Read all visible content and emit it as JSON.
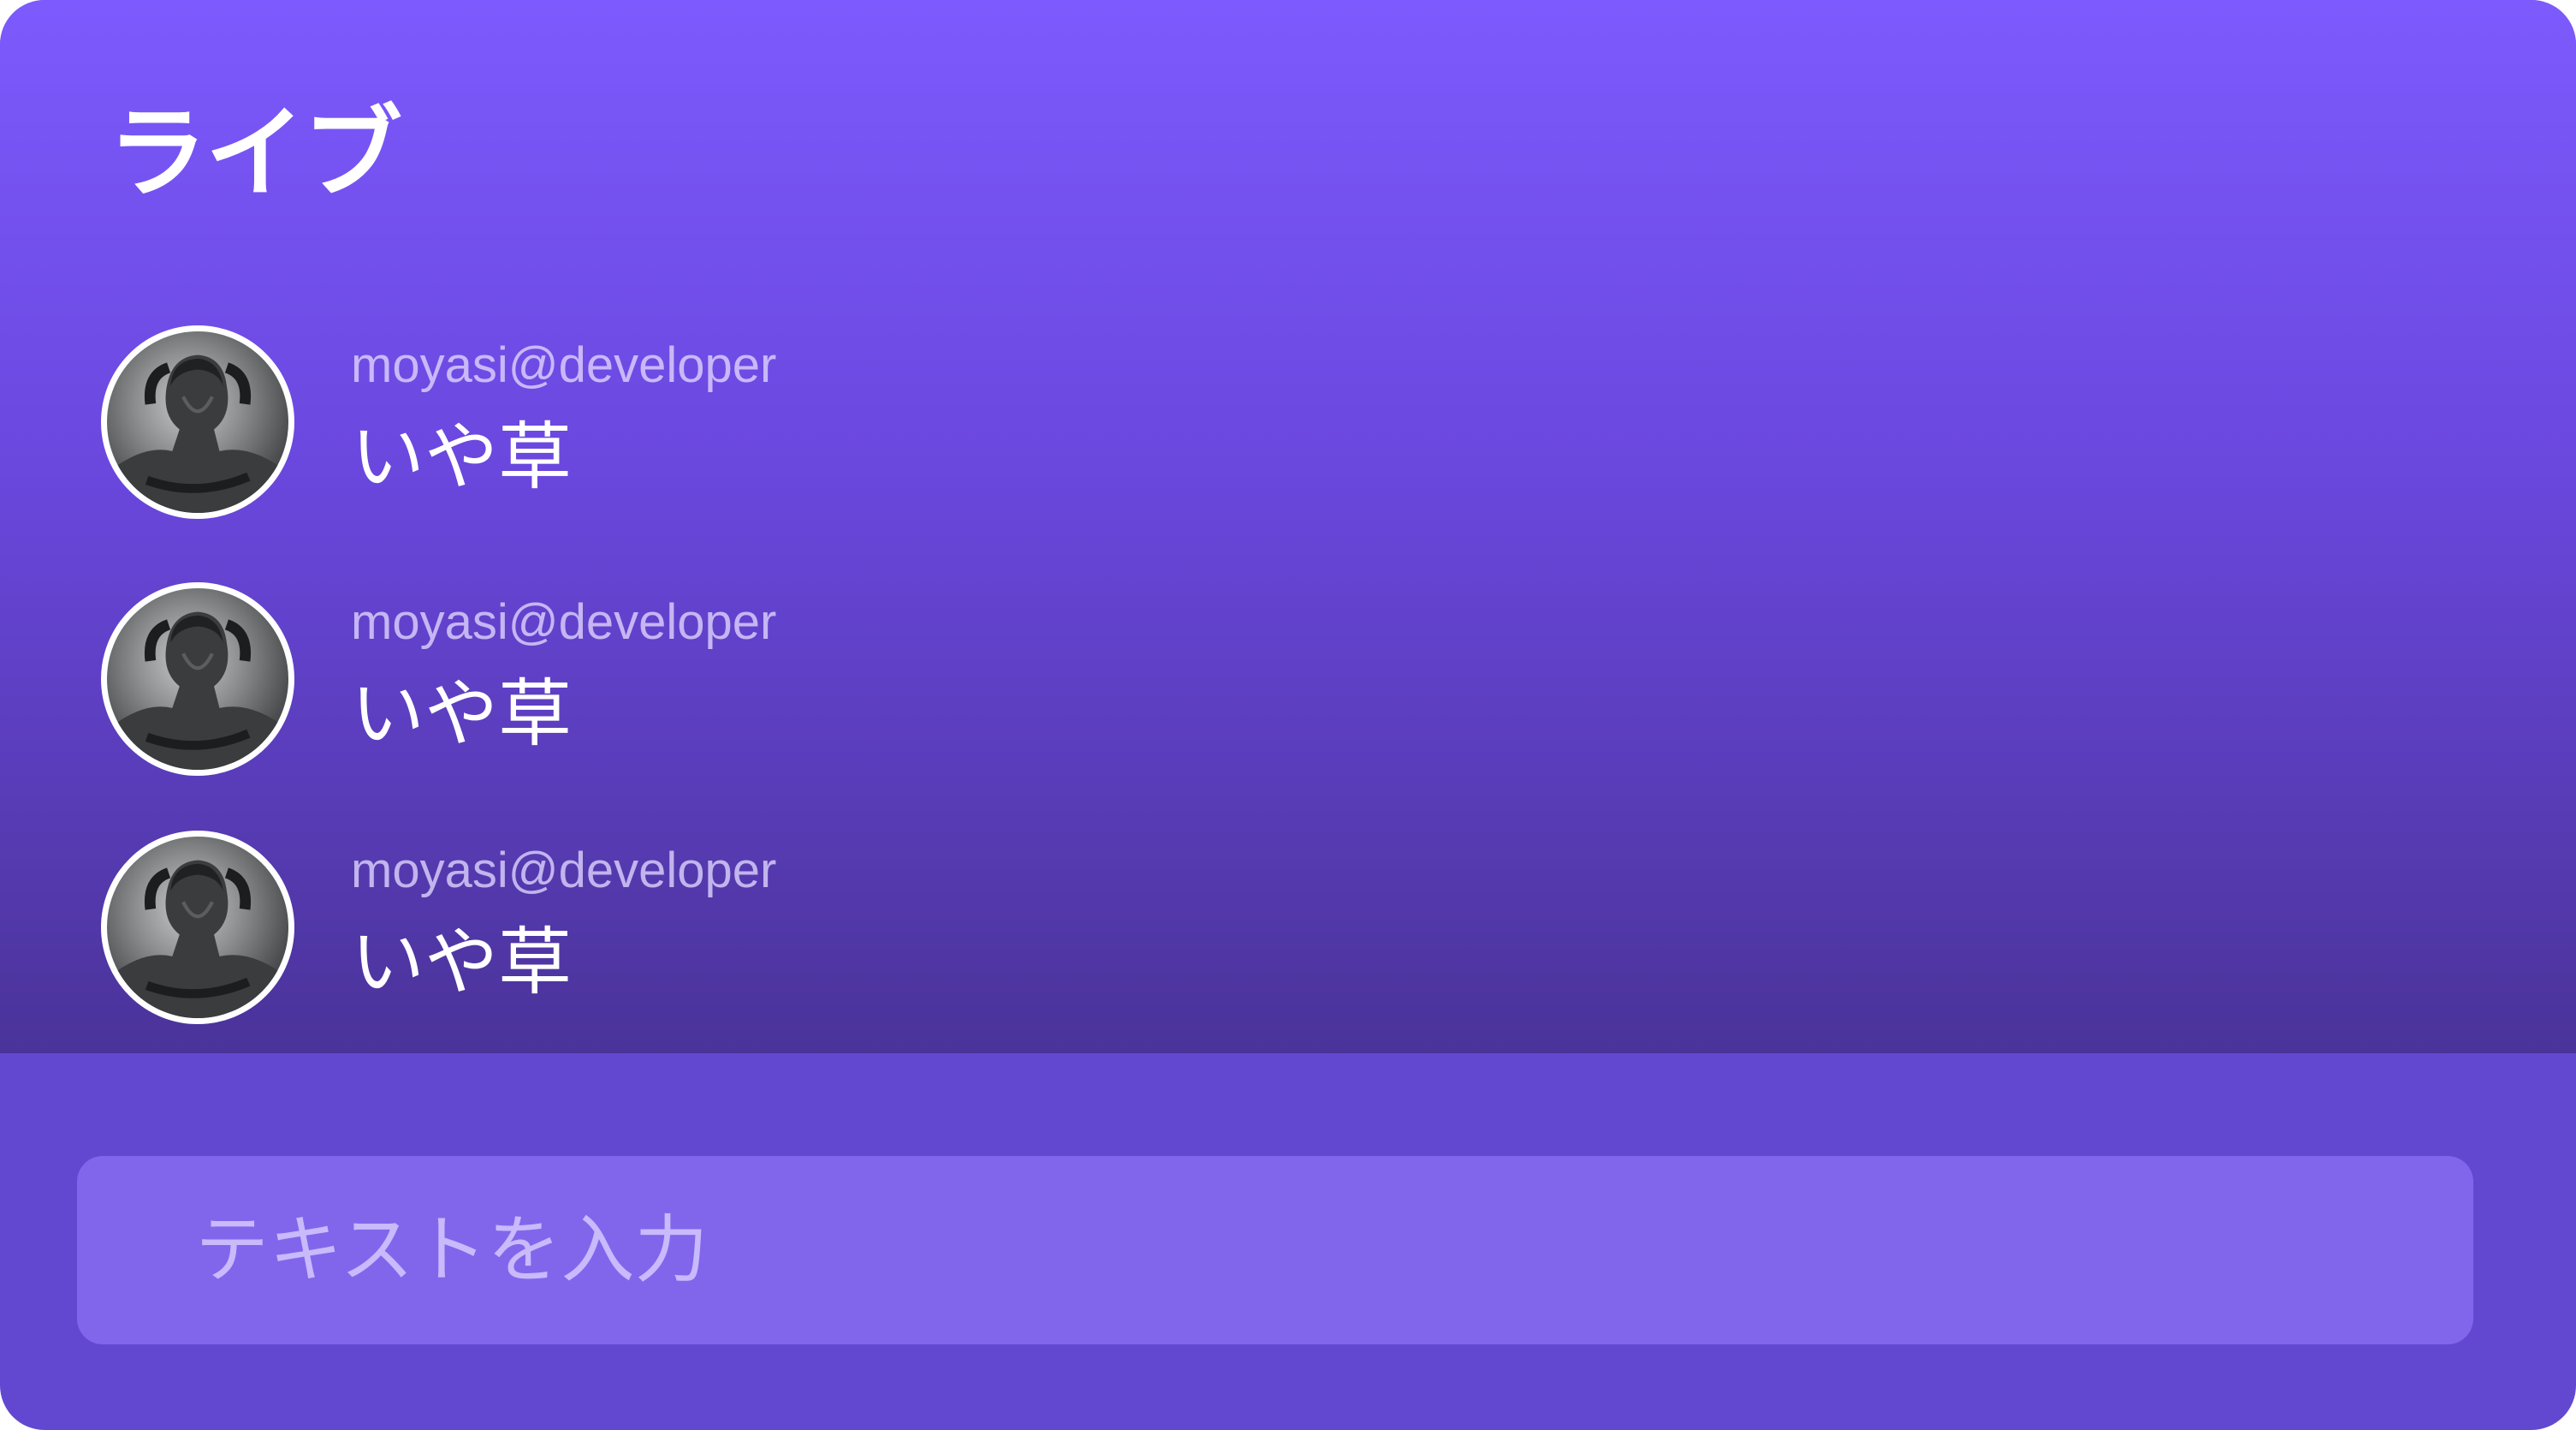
{
  "header": {
    "title": "ライブ"
  },
  "messages": [
    {
      "username": "moyasi@developer",
      "text": "いや草",
      "avatar_icon": "statue-avatar-icon"
    },
    {
      "username": "moyasi@developer",
      "text": "いや草",
      "avatar_icon": "statue-avatar-icon"
    },
    {
      "username": "moyasi@developer",
      "text": "いや草",
      "avatar_icon": "statue-avatar-icon"
    }
  ],
  "composer": {
    "placeholder": "テキストを入力",
    "value": ""
  },
  "colors": {
    "gradient_top": "#7c5afd",
    "gradient_bottom": "#4a3399",
    "footer_background": "#6248d0",
    "input_background": "#8166ec",
    "text_primary": "#ffffff"
  }
}
